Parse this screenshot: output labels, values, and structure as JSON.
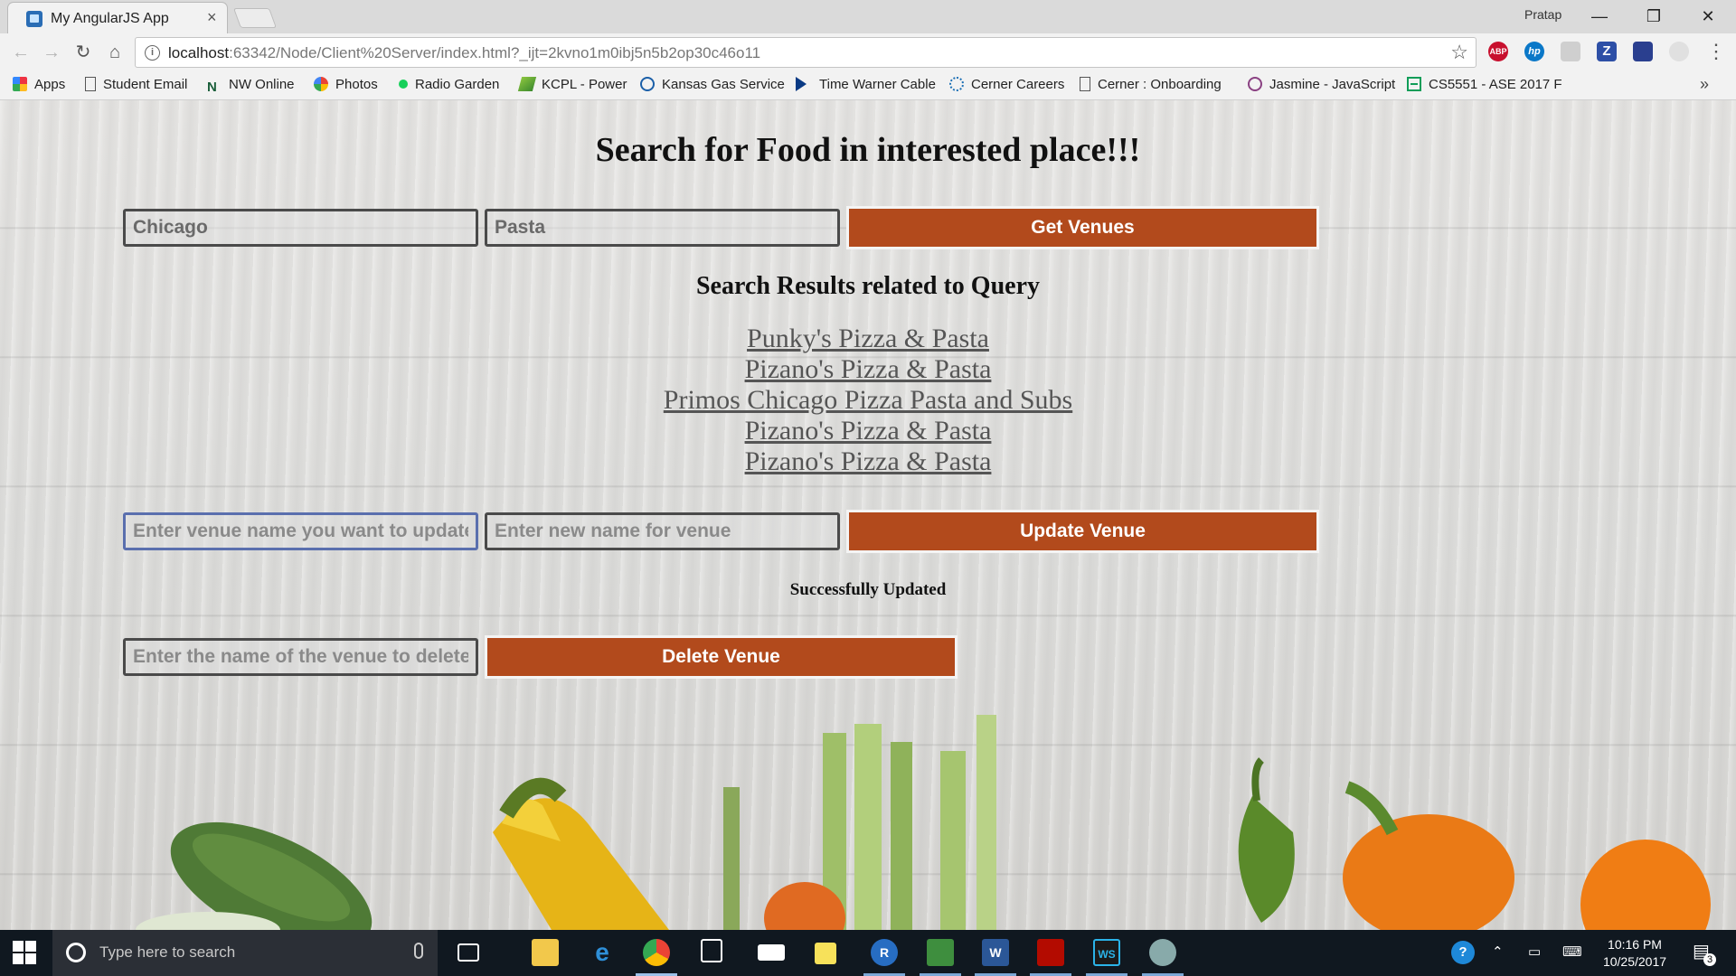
{
  "browser": {
    "tab_title": "My AngularJS App",
    "tab_close": "×",
    "profile_name": "Pratap",
    "window_buttons": {
      "minimize": "—",
      "restore": "❐",
      "close": "✕"
    },
    "url_host": "localhost",
    "url_rest": ":63342/Node/Client%20Server/index.html?_ijt=2kvno1m0ibj5n5b2op30c46o11",
    "extensions": [
      "ABP",
      "hp",
      "Z"
    ],
    "bookmarks": [
      "Apps",
      "Student Email",
      "NW Online",
      "Photos",
      "Radio Garden",
      "KCPL - Power",
      "Kansas Gas Service",
      "Time Warner Cable",
      "Cerner Careers",
      "Cerner : Onboarding",
      "Jasmine - JavaScript",
      "CS5551 - ASE 2017 F"
    ],
    "bookmarks_more": "»"
  },
  "page": {
    "heading": "Search for Food in interested place!!!",
    "search": {
      "location_value": "Chicago",
      "query_value": "Pasta",
      "button": "Get Venues"
    },
    "results_heading": "Search Results related to Query",
    "results": [
      "Punky's Pizza & Pasta",
      "Pizano's Pizza & Pasta",
      "Primos Chicago Pizza Pasta and Subs",
      "Pizano's Pizza & Pasta",
      "Pizano's Pizza & Pasta"
    ],
    "update": {
      "old_name_placeholder": "Enter venue name you want to update",
      "new_name_placeholder": "Enter new name for venue",
      "button": "Update Venue"
    },
    "status_message": "Successfully Updated",
    "delete": {
      "name_placeholder": "Enter the name of the venue to delete",
      "button": "Delete Venue"
    }
  },
  "taskbar": {
    "search_placeholder": "Type here to search",
    "time": "10:16 PM",
    "date": "10/25/2017",
    "notification_count": "3"
  },
  "colors": {
    "button_bg": "#b24a1c",
    "taskbar_bg": "#101820"
  }
}
